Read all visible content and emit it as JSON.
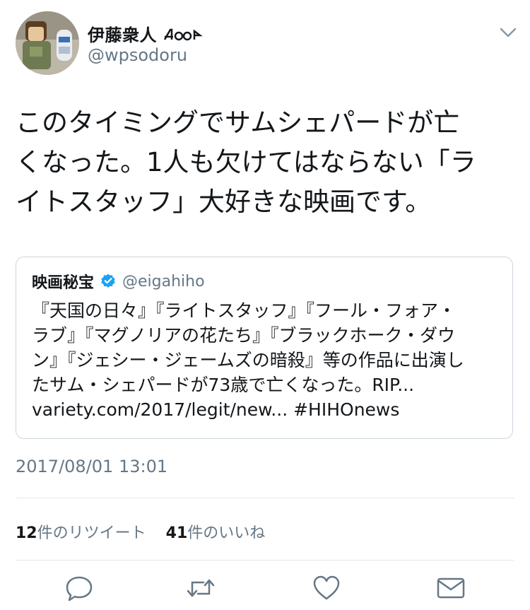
{
  "author": {
    "display_name": "伊藤衆人",
    "handle": "@wpsodoru"
  },
  "tweet": {
    "text": "このタイミングでサムシェパードが亡\nくなった。1人も欠けてはならない「ラ\nイトスタッフ」大好きな映画です。"
  },
  "quoted": {
    "name": "映画秘宝",
    "handle": "@eigahiho",
    "text": "『天国の日々』『ライトスタッフ』『フール・フォア・\nラブ』『マグノリアの花たち』『ブラックホーク・ダウ\nン』『ジェシー・ジェームズの暗殺』等の作品に出演し\nたサム・シェパードが73歳で亡くなった。RIP...\nvariety.com/2017/legit/new... #HIHOnews"
  },
  "timestamp": "2017/08/01 13:01",
  "stats": {
    "retweet_count": "12",
    "retweet_label": "件のリツイート",
    "like_count": "41",
    "like_label": "件のいいね"
  },
  "actions": [
    "reply-icon",
    "retweet-icon",
    "like-icon",
    "share-mail-icon"
  ],
  "colors": {
    "text": "#14171a",
    "secondary": "#657786",
    "border": "#ccd6dd",
    "verified": "#1da1f2"
  }
}
